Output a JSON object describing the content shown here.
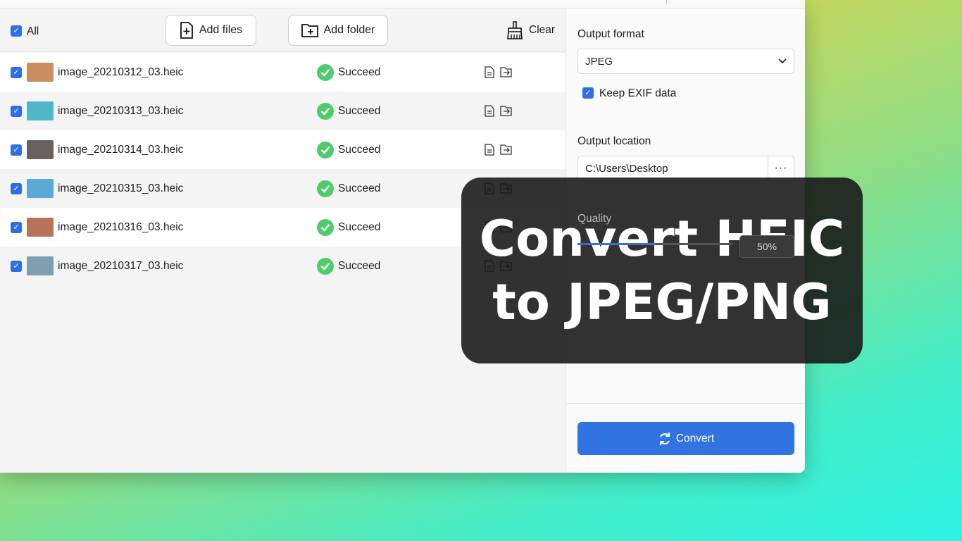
{
  "toolbar": {
    "select_all_label": "All",
    "add_files_label": "Add files",
    "add_folder_label": "Add folder",
    "clear_label": "Clear"
  },
  "files": [
    {
      "name": "image_20210312_03.heic",
      "status": "Succeed",
      "thumb": "#c98d5e"
    },
    {
      "name": "image_20210313_03.heic",
      "status": "Succeed",
      "thumb": "#4fb7c8"
    },
    {
      "name": "image_20210314_03.heic",
      "status": "Succeed",
      "thumb": "#6b6060"
    },
    {
      "name": "image_20210315_03.heic",
      "status": "Succeed",
      "thumb": "#5aa9d6"
    },
    {
      "name": "image_20210316_03.heic",
      "status": "Succeed",
      "thumb": "#b6735a"
    },
    {
      "name": "image_20210317_03.heic",
      "status": "Succeed",
      "thumb": "#7d9fae"
    }
  ],
  "settings": {
    "output_format_label": "Output format",
    "output_format_value": "JPEG",
    "keep_exif_label": "Keep EXIF data",
    "keep_exif_checked": true,
    "output_location_label": "Output location",
    "output_location_value": "C:\\Users\\Desktop",
    "browse_label": "···",
    "quality_label": "Quality",
    "quality_value": "50%",
    "quality_percent": 50,
    "convert_label": "Convert"
  },
  "overlay": {
    "line1": "Convert HEIC",
    "line2": "to JPEG/PNG"
  },
  "colors": {
    "accent": "#3273e2",
    "success": "#4ecb6a"
  }
}
